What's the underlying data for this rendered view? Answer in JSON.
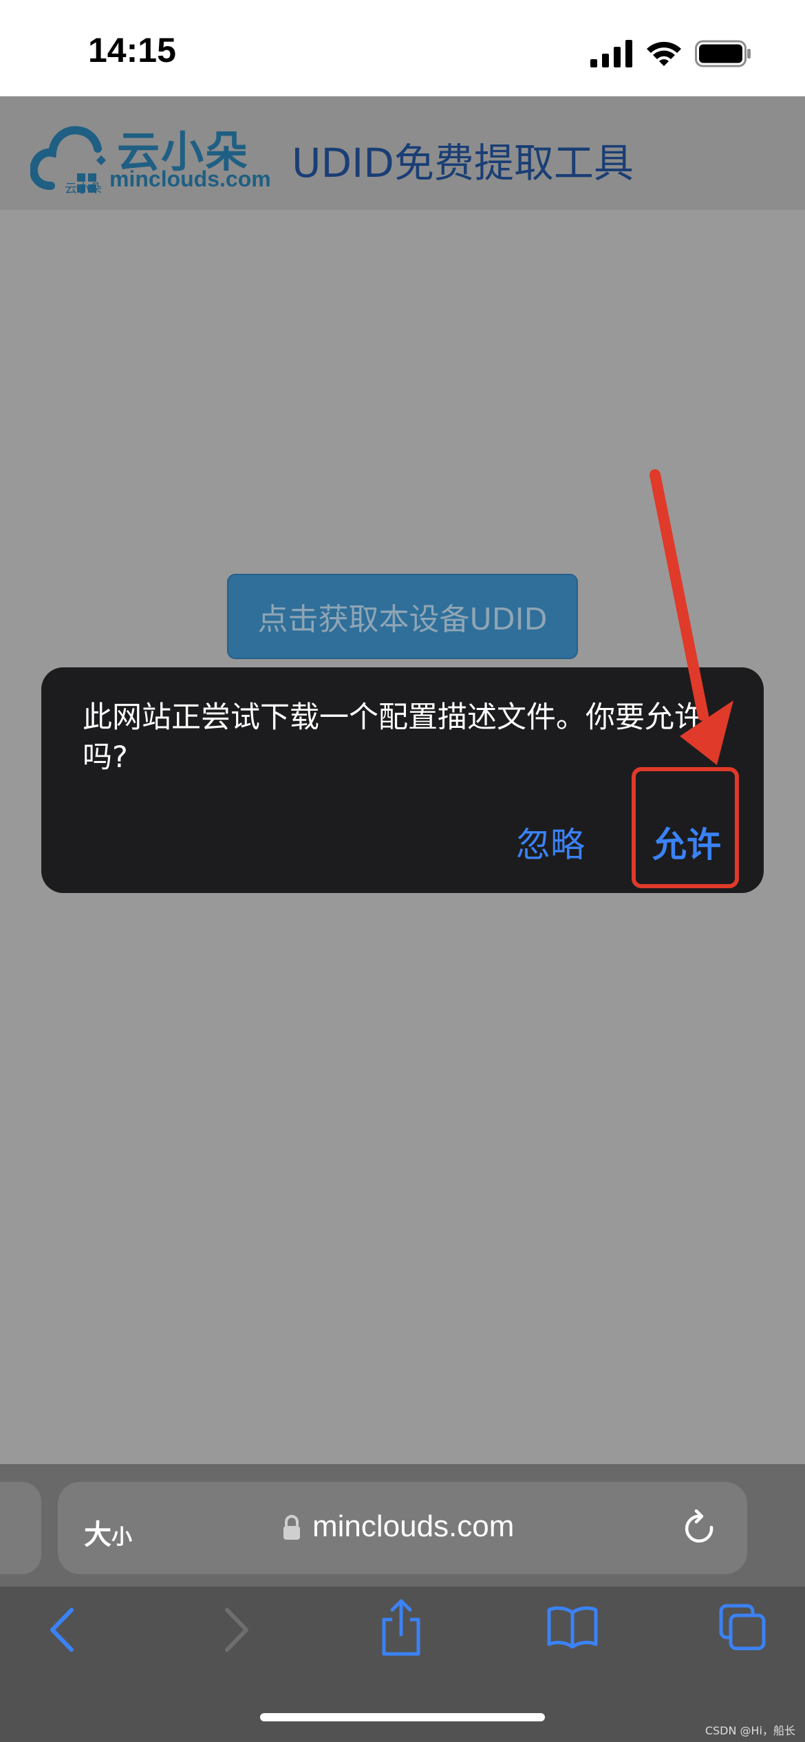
{
  "status_bar": {
    "time": "14:15"
  },
  "site": {
    "logo_text": "云小朵",
    "logo_domain": "minclouds.com",
    "logo_small": "云小朵",
    "header_title": "UDID免费提取工具",
    "get_udid_button": "点击获取本设备UDID"
  },
  "dialog": {
    "message": "此网站正尝试下载一个配置描述文件。你要允许吗?",
    "ignore_label": "忽略",
    "allow_label": "允许"
  },
  "safari": {
    "text_size_label_big": "大",
    "text_size_label_small": "小",
    "url": "minclouds.com"
  },
  "watermark": "CSDN @Hi，船长",
  "colors": {
    "accent": "#3b82f6",
    "annotation": "#e03a2a"
  }
}
